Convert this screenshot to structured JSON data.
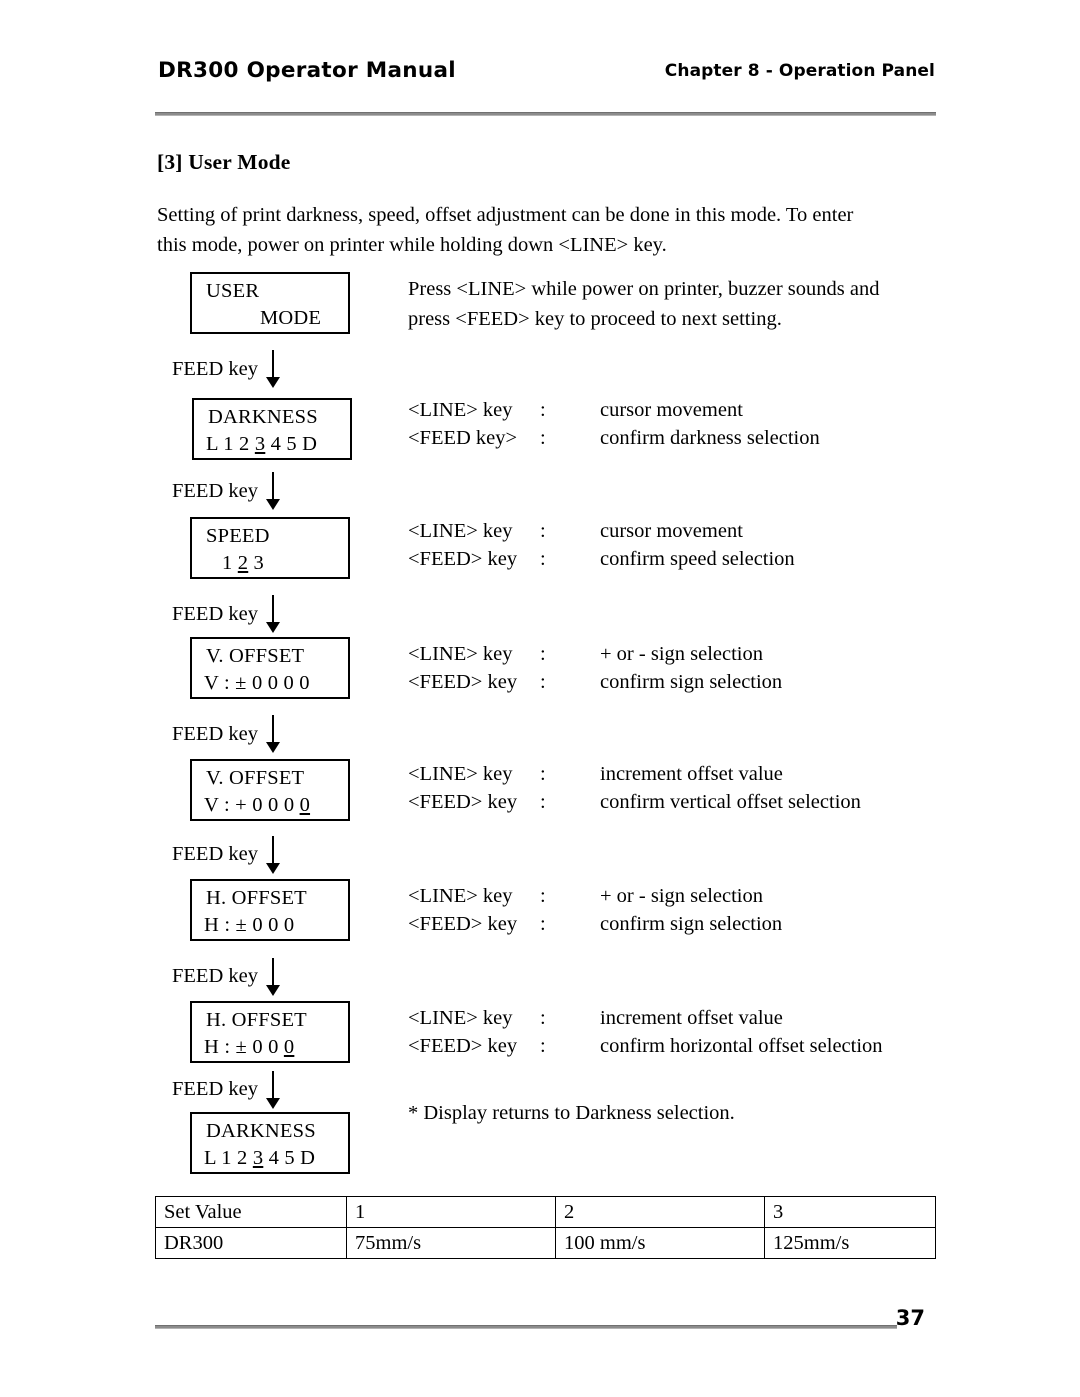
{
  "header": {
    "left_title": "DR300 Operator Manual",
    "right_title": "Chapter 8 - Operation Panel"
  },
  "footer": {
    "page_number": "37"
  },
  "section": {
    "title": "[3] User Mode",
    "intro_line1": "Setting of print darkness, speed, offset adjustment can be done in this mode.  To enter",
    "intro_line2": "this mode, power on printer while holding down <LINE> key."
  },
  "labels": {
    "feed_key": "FEED key"
  },
  "steps": [
    {
      "lcd_line1": "USER",
      "lcd_line2": "MODE",
      "description_line1": "Press <LINE> while power on printer, buzzer sounds and",
      "description_line2": "press <FEED> key to proceed to next setting."
    },
    {
      "lcd_line1": "DARKNESS",
      "lcd_pre": "L 1 2 ",
      "lcd_cursor": "3",
      "lcd_post": " 4 5 D",
      "key1": "<LINE> key",
      "colon1": ":",
      "action1": "cursor movement",
      "key2": "<FEED key>",
      "colon2": ":",
      "action2": "confirm darkness selection"
    },
    {
      "lcd_line1": "SPEED",
      "lcd_pre": "1 ",
      "lcd_cursor": "2",
      "lcd_post": " 3",
      "key1": "<LINE> key",
      "colon1": ":",
      "action1": "cursor movement",
      "key2": "<FEED> key",
      "colon2": ":",
      "action2": "confirm speed selection"
    },
    {
      "lcd_line1": "V. OFFSET",
      "lcd_pre": "V : ± 0 0 0 0",
      "lcd_cursor": "",
      "lcd_post": "",
      "key1": "<LINE> key",
      "colon1": ":",
      "action1": "+ or - sign selection",
      "key2": "<FEED> key",
      "colon2": ":",
      "action2": "confirm sign selection"
    },
    {
      "lcd_line1": "V. OFFSET",
      "lcd_pre": "V : + 0 0 0 ",
      "lcd_cursor": "0",
      "lcd_post": "",
      "key1": "<LINE> key",
      "colon1": ":",
      "action1": "increment offset value",
      "key2": "<FEED> key",
      "colon2": ":",
      "action2": "confirm vertical offset selection"
    },
    {
      "lcd_line1": "H. OFFSET",
      "lcd_pre": "H : ± 0 0 0",
      "lcd_cursor": "",
      "lcd_post": "",
      "key1": "<LINE> key",
      "colon1": ":",
      "action1": "+ or - sign selection",
      "key2": "<FEED> key",
      "colon2": ":",
      "action2": "confirm sign selection"
    },
    {
      "lcd_line1": "H. OFFSET",
      "lcd_pre": "H : ± 0 0 ",
      "lcd_cursor": "0",
      "lcd_post": "",
      "key1": "<LINE> key",
      "colon1": ":",
      "action1": "increment offset value",
      "key2": "<FEED> key",
      "colon2": ":",
      "action2": "confirm horizontal offset selection"
    },
    {
      "lcd_line1": "DARKNESS",
      "lcd_pre": "L 1 2 ",
      "lcd_cursor": "3",
      "lcd_post": " 4 5 D",
      "note": "* Display returns to Darkness selection."
    }
  ],
  "table": {
    "header_row": [
      "Set Value",
      "1",
      "2",
      "3"
    ],
    "data_row": [
      "DR300",
      "75mm/s",
      "100 mm/s",
      "125mm/s"
    ]
  }
}
